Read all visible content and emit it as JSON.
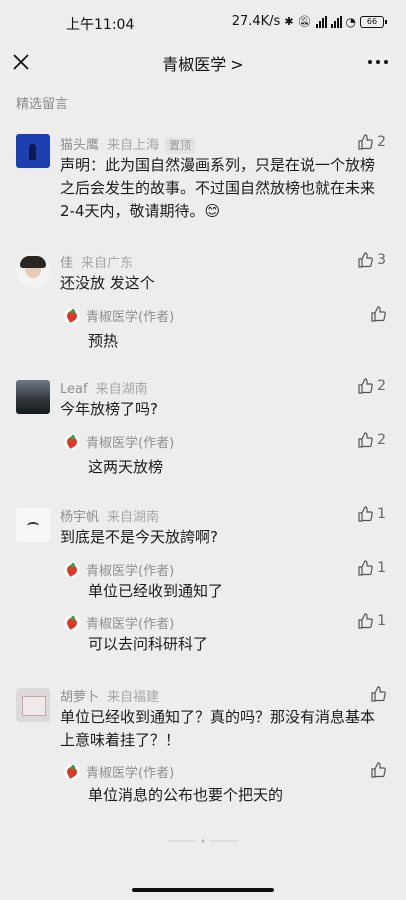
{
  "status_bar": {
    "time": "上午11:04",
    "net_speed": "27.4K/s",
    "battery": "66"
  },
  "nav": {
    "title": "青椒医学",
    "chevron": ">"
  },
  "section_label": "精选留言",
  "comments": [
    {
      "author": "猫头鹰",
      "location": "来自上海",
      "tag": "置顶",
      "likes": "2",
      "text": "声明：此为国自然漫画系列，只是在说一个放榜之后会发生的故事。不过国自然放榜也就在未来2-4天内，敬请期待。😊",
      "replies": []
    },
    {
      "author": "佳",
      "location": "来自广东",
      "likes": "3",
      "text": "还没放 发这个",
      "replies": [
        {
          "author": "青椒医学(作者)",
          "text": "预热",
          "likes": ""
        }
      ]
    },
    {
      "author": "Leaf",
      "location": "来自湖南",
      "likes": "2",
      "text": "今年放榜了吗?",
      "replies": [
        {
          "author": "青椒医学(作者)",
          "text": "这两天放榜",
          "likes": "2"
        }
      ]
    },
    {
      "author": "杨宇帆",
      "location": "来自湖南",
      "likes": "1",
      "text": "到底是不是今天放誇啊?",
      "replies": [
        {
          "author": "青椒医学(作者)",
          "text": "单位已经收到通知了",
          "likes": "1"
        },
        {
          "author": "青椒医学(作者)",
          "text": "可以去问科研科了",
          "likes": "1"
        }
      ]
    },
    {
      "author": "胡萝卜",
      "location": "来自福建",
      "likes": "",
      "text": "单位已经收到通知了？真的吗？那没有消息基本上意味着挂了？！",
      "replies": [
        {
          "author": "青椒医学(作者)",
          "text": "单位消息的公布也要个把天的",
          "likes": ""
        }
      ]
    }
  ],
  "icons": {
    "close": "close-icon",
    "more": "more-icon",
    "like": "thumbs-up-icon",
    "logo": "qingjiao-logo-icon"
  },
  "colors": {
    "background": "#ededed",
    "meta_text": "#8f8f8f",
    "body_text": "#1b1b1b"
  }
}
